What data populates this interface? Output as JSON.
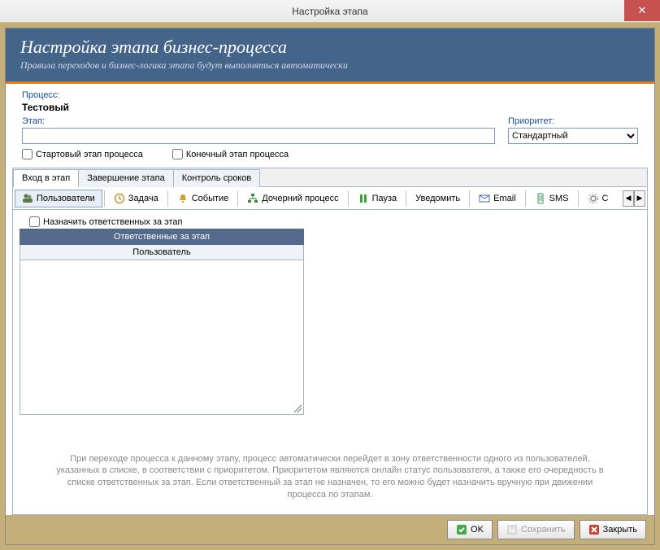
{
  "window": {
    "title": "Настройка этапа"
  },
  "header": {
    "title": "Настройка этапа бизнес-процесса",
    "subtitle": "Правила переходов и бизнес-логика этапа будут выполняться автоматически"
  },
  "form": {
    "process_label": "Процесс:",
    "process_value": "Тестовый",
    "stage_label": "Этап:",
    "stage_value": "",
    "priority_label": "Приоритет:",
    "priority_value": "Стандартный",
    "chk_start": "Стартовый этап  процесса",
    "chk_end": "Конечный этап процесса"
  },
  "tabs_top": {
    "t0": "Вход в этап",
    "t1": "Завершение этапа",
    "t2": "Контроль сроков"
  },
  "toolbar": {
    "users": "Пользователи",
    "task": "Задача",
    "event": "Событие",
    "child": "Дочерний процесс",
    "pause": "Пауза",
    "notify": "Уведомить",
    "email": "Email",
    "sms": "SMS",
    "more": "С"
  },
  "resp": {
    "chk": "Назначить ответственных за этап",
    "header": "Ответственные за этап",
    "subheader": "Пользователь"
  },
  "help": "При переходе процесса к данному этапу, процесс автоматически перейдет в зону ответственности одного из пользователей, указанных в списке, в соответствии с приоритетом. Приоритетом являются онлайн статус пользователя, а также его очередность в списке ответственных за этап. Если ответственный за этап не назначен, то его можно будет назначить вручную при движении процесса по этапам.",
  "buttons": {
    "ok": "OK",
    "save": "Сохранить",
    "close": "Закрыть"
  }
}
